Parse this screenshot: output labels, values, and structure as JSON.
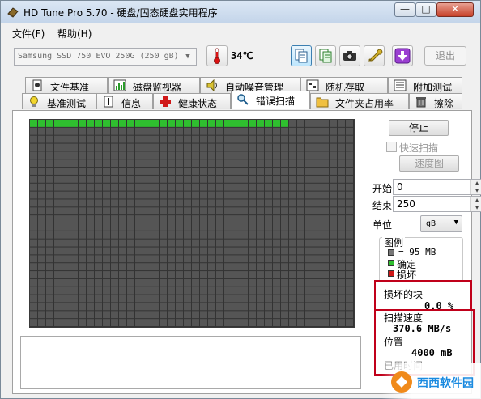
{
  "window": {
    "title": "HD Tune Pro 5.70 - 硬盘/固态硬盘实用程序",
    "min_glyph": "—",
    "max_glyph": "□",
    "close_glyph": "✕"
  },
  "menu": {
    "file": "文件(F)",
    "help": "帮助(H)"
  },
  "toolbar": {
    "drive": "Samsung SSD 750 EVO 250G (250 gB)",
    "temperature": "34℃",
    "exit": "退出"
  },
  "tabs": {
    "row_back": [
      "文件基准",
      "磁盘监视器",
      "自动噪音管理",
      "随机存取",
      "附加测试"
    ],
    "row_front": [
      "基准测试",
      "信息",
      "健康状态",
      "错误扫描",
      "文件夹占用率",
      "擦除"
    ],
    "selected": "错误扫描"
  },
  "scan": {
    "grid": {
      "columns": 40,
      "rows": 26,
      "scanned_blocks": 32,
      "scanned_color": "#2fbf2f",
      "unscanned_color": "#555555",
      "line_color": "#333333"
    },
    "stop_button": "停止",
    "quick_scan_label": "快速扫描",
    "speed_map_button": "速度图",
    "start_label": "开始",
    "start_value": "0",
    "end_label": "结束",
    "end_value": "250",
    "unit_label": "单位",
    "unit_value": "gB",
    "legend_title": "图例",
    "legend_block": "= 95 MB",
    "legend_ok": "确定",
    "legend_bad": "损坏",
    "legend_ok_color": "#2fbf2f",
    "legend_bad_color": "#d01818",
    "legend_block_color": "#777777",
    "damaged_label": "损坏的块",
    "damaged_value": "0.0 %",
    "speed_label": "扫描速度",
    "speed_value": "370.6 MB/s",
    "position_label": "位置",
    "position_value": "4000 mB",
    "elapsed_label": "已用时间"
  },
  "watermark": "西西软件园",
  "colors": {
    "highlight_red": "#c0001a",
    "titlebar": "#c4d5ea"
  }
}
